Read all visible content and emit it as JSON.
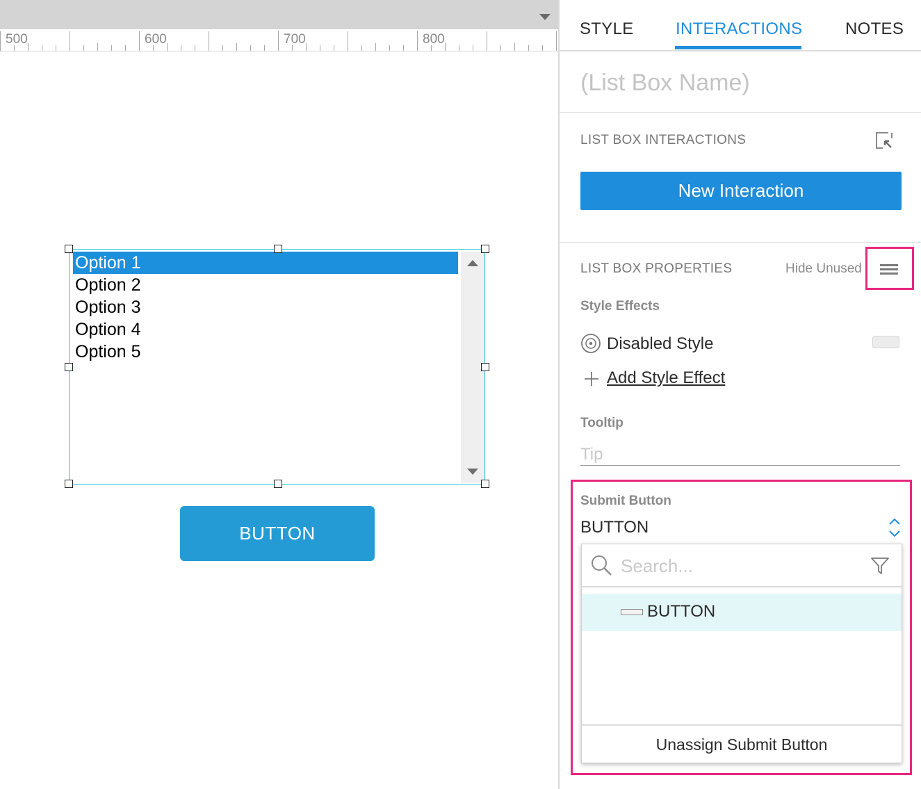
{
  "ruler": {
    "labels": [
      "500",
      "600",
      "700",
      "800"
    ]
  },
  "listbox": {
    "options": [
      "Option 1",
      "Option 2",
      "Option 3",
      "Option 4",
      "Option 5"
    ],
    "selected_index": 0
  },
  "canvas_button": {
    "label": "BUTTON"
  },
  "panel": {
    "tabs": [
      {
        "label": "STYLE",
        "active": false
      },
      {
        "label": "INTERACTIONS",
        "active": true
      },
      {
        "label": "NOTES",
        "active": false
      }
    ],
    "name_placeholder": "(List Box Name)",
    "interactions": {
      "section_label": "LIST BOX INTERACTIONS",
      "new_button_label": "New Interaction"
    },
    "properties": {
      "section_label": "LIST BOX PROPERTIES",
      "hide_unused_label": "Hide Unused",
      "style_effects_label": "Style Effects",
      "disabled_style_label": "Disabled Style",
      "add_style_effect_label": "Add Style Effect",
      "tooltip_label": "Tooltip",
      "tooltip_placeholder": "Tip",
      "submit_button_label": "Submit Button",
      "submit_button_value": "BUTTON"
    },
    "dropdown": {
      "search_placeholder": "Search...",
      "items": [
        "BUTTON"
      ],
      "footer_label": "Unassign Submit Button"
    }
  },
  "colors": {
    "accent": "#1e8ddb",
    "highlight": "#e8277f",
    "selection_outline": "#26c3d9",
    "canvas_button": "#259bd5"
  },
  "icons": [
    "ruler-dropdown-icon",
    "scroll-up-icon",
    "scroll-down-icon",
    "popout-icon",
    "menu-icon",
    "disabled-style-icon",
    "plus-icon",
    "select-arrows-icon",
    "search-icon",
    "filter-icon",
    "button-widget-icon"
  ]
}
